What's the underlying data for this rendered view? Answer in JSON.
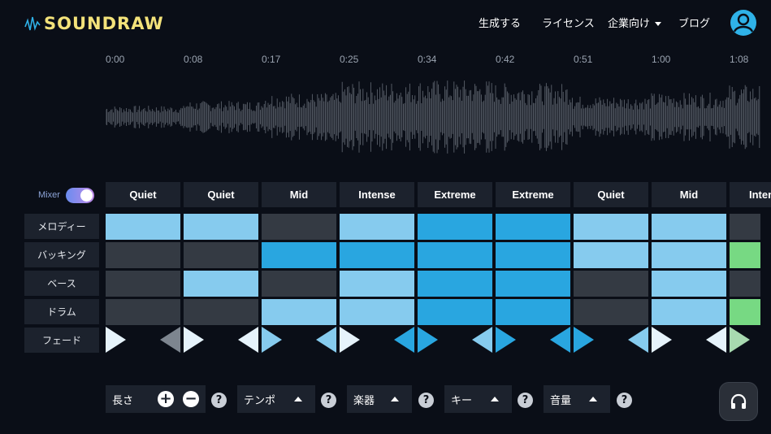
{
  "brand": {
    "logo_text": "SOUNDRAW",
    "logo_color": "#f3e27a"
  },
  "nav": {
    "generate": "生成する",
    "license": "ライセンス",
    "business": "企業向け",
    "blog": "ブログ"
  },
  "timeline": [
    "0:00",
    "0:08",
    "0:17",
    "0:25",
    "0:34",
    "0:42",
    "0:51",
    "1:00",
    "1:08"
  ],
  "mixer": {
    "label": "Mixer",
    "enabled": true
  },
  "sections": [
    "Quiet",
    "Quiet",
    "Mid",
    "Intense",
    "Extreme",
    "Extreme",
    "Quiet",
    "Mid",
    "Intense"
  ],
  "tracks": [
    {
      "label": "メロディー",
      "levels": [
        1,
        1,
        0,
        1,
        2,
        2,
        1,
        1,
        0
      ]
    },
    {
      "label": "バッキング",
      "levels": [
        0,
        0,
        2,
        2,
        2,
        2,
        1,
        1,
        3
      ]
    },
    {
      "label": "ベース",
      "levels": [
        0,
        1,
        0,
        1,
        2,
        2,
        0,
        1,
        0
      ]
    },
    {
      "label": "ドラム",
      "levels": [
        0,
        0,
        1,
        1,
        2,
        2,
        0,
        1,
        3
      ]
    }
  ],
  "fade": {
    "label": "フェード",
    "fade_in": [
      1,
      1,
      2,
      1,
      3,
      3,
      3,
      1,
      4
    ],
    "fade_out": [
      0,
      1,
      2,
      3,
      2,
      3,
      2,
      1,
      0
    ]
  },
  "colors": {
    "level_0": "#343a43",
    "level_1": "#86cbee",
    "level_2": "#29a6e0",
    "level_3": "#77d983",
    "accent": "#2fb2e8",
    "fade_0": "#7d858f",
    "fade_1": "#e6f3fb",
    "fade_2": "#86cbee",
    "fade_3": "#29a6e0",
    "fade_4": "#a8d9b0"
  },
  "controls": {
    "length": "長さ",
    "tempo": "テンポ",
    "instrument": "楽器",
    "key": "キー",
    "volume": "音量",
    "plus_icon": "+",
    "minus_icon": "−",
    "help_icon": "?"
  },
  "icons": [
    "wave-logo-icon",
    "user-avatar-icon",
    "chevron-down-icon",
    "plus-icon",
    "minus-icon",
    "help-icon",
    "headphones-icon"
  ]
}
